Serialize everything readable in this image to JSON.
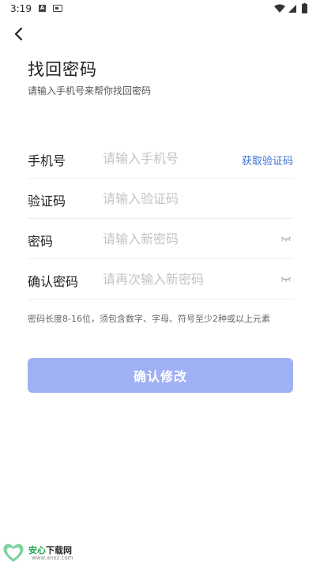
{
  "status_bar": {
    "time": "3:19",
    "notification_icon_letter": "A"
  },
  "header": {
    "title": "找回密码",
    "subtitle": "请输入手机号来帮你找回密码"
  },
  "form": {
    "phone": {
      "label": "手机号",
      "placeholder": "请输入手机号",
      "action": "获取验证码"
    },
    "code": {
      "label": "验证码",
      "placeholder": "请输入验证码"
    },
    "password": {
      "label": "密码",
      "placeholder": "请输入新密码"
    },
    "confirm": {
      "label": "确认密码",
      "placeholder": "请再次输入新密码"
    }
  },
  "hint": "密码长度8-16位，须包含数字、字母、符号至少2种或以上元素",
  "submit_label": "确认修改",
  "watermark": {
    "name_prefix": "安心",
    "name_suffix": "下载网",
    "url": "www.anxz.com"
  },
  "colors": {
    "accent_link": "#3c6fd6",
    "button_disabled": "#9fb0f5",
    "placeholder": "#c4c4c4",
    "watermark_green": "#1fa24a"
  }
}
